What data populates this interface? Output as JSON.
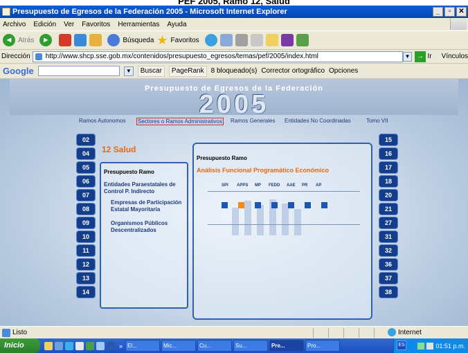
{
  "caption": "PEF 2005, Ramo 12, Salud",
  "window": {
    "title": "Presupuesto de Egresos de la Federación 2005 - Microsoft Internet Explorer",
    "controls": [
      "_",
      "▫",
      "✕"
    ]
  },
  "menu": [
    "Archivo",
    "Edición",
    "Ver",
    "Favoritos",
    "Herramientas",
    "Ayuda"
  ],
  "toolbar": {
    "back": "Atrás",
    "search": "Búsqueda",
    "favorites": "Favoritos"
  },
  "address": {
    "label": "Dirección",
    "url": "http://www.shcp.sse.gob.mx/contenidos/presupuesto_egresos/temas/pef/2005/index.html",
    "go": "Ir",
    "links": "Vínculos"
  },
  "google": {
    "logo": "Google",
    "search": "Buscar",
    "pagerank": "PageRank",
    "blocked": "8 bloqueado(s)",
    "spell": "Corrector ortográfico",
    "options": "Opciones"
  },
  "page": {
    "header_title": "Presupuesto de Egresos de la Federación",
    "year": "2005",
    "nav": [
      "Ramos Autonomos",
      "Sectores o Ramos Administrativos",
      "Ramos Generales",
      "Entidades No Coordinadas",
      "Tomo VII"
    ],
    "left_numbers": [
      "02",
      "04",
      "05",
      "06",
      "07",
      "08",
      "09",
      "10",
      "11",
      "12",
      "13",
      "14"
    ],
    "right_numbers": [
      "15",
      "16",
      "17",
      "18",
      "20",
      "21",
      "27",
      "31",
      "32",
      "36",
      "37",
      "38"
    ],
    "dept_title": "12 Salud",
    "left_panel": {
      "heading": "Presupuesto Ramo",
      "item1": "Entidades Paraestatales de Control P. Indirecto",
      "item2": "Empresas de Participación Estatal Mayoritaria",
      "item3": "Organismos Públicos Descentralizados"
    },
    "right_panel": {
      "heading": "Presupuesto Ramo",
      "subtitle": "Análisis Funcional Programático Económico",
      "functions": [
        "SPI",
        "APPS",
        "MP",
        "FEDD",
        "AAE",
        "PR",
        "AP"
      ]
    }
  },
  "status": {
    "text": "Listo",
    "zone": "Internet"
  },
  "taskbar": {
    "start": "Inicio",
    "overflow": "»",
    "tasks": [
      "El...",
      "Mic...",
      "Cu...",
      "Su...",
      "Pre...",
      "Pro..."
    ],
    "lang": "ES",
    "clock": "01:51 p.m."
  },
  "colors": {
    "accent_orange": "#e36a12",
    "nav_blue": "#143e8c",
    "selected_square": "#f08a1d"
  }
}
